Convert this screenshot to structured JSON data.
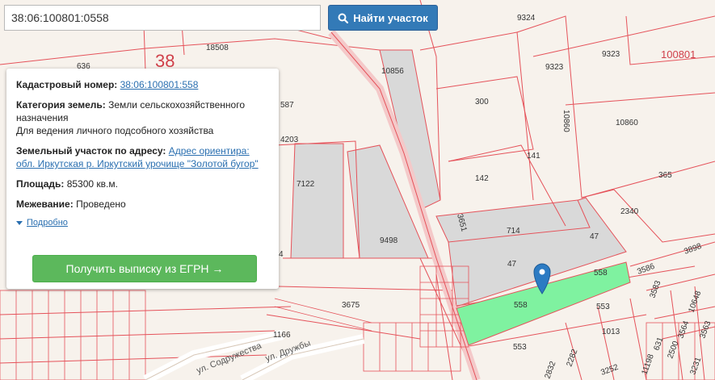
{
  "search": {
    "value": "38:06:100801:0558"
  },
  "search_button": {
    "label": "Найти участок",
    "icon": "search-icon"
  },
  "map_labels": {
    "region_number": "38",
    "block_number": "100801",
    "parcels": [
      "9324",
      "9323",
      "9323",
      "18508",
      "636",
      "10856",
      "587",
      "4203",
      "300",
      "10860",
      "10860",
      "141",
      "142",
      "7122",
      "365",
      "2340",
      "3651",
      "714",
      "47",
      "47",
      "9498",
      "4",
      "558",
      "558",
      "553",
      "1013",
      "553",
      "3675",
      "1166",
      "3586",
      "3898",
      "3583",
      "10648",
      "3564",
      "3563",
      "2500",
      "2282",
      "631",
      "11198",
      "3252",
      "3231",
      "2832"
    ],
    "streets": [
      "ул. Содружества",
      "ул. Дружбы"
    ]
  },
  "card": {
    "cadastral_label": "Кадастровый номер:",
    "cadastral_value": "38:06:100801:558",
    "category_label": "Категория земель:",
    "category_value": "Земли сельскохозяйственного назначения",
    "category_use": "Для ведения личного подсобного хозяйства",
    "address_label": "Земельный участок по адресу:",
    "address_value": "Адрес ориентира: обл. Иркутская р. Иркутский урочище \"Золотой бугор\"",
    "area_label": "Площадь:",
    "area_value": "85300 кв.м.",
    "survey_label": "Межевание:",
    "survey_value": "Проведено",
    "more_label": "Подробно",
    "egrn_button": "Получить выписку из ЕГРН →"
  },
  "colors": {
    "parcel_line": "#e5525a",
    "highlight": "#7ff2a0",
    "pin": "#2c7bc3",
    "button_blue": "#337ab7",
    "button_green": "#5cb85c"
  }
}
